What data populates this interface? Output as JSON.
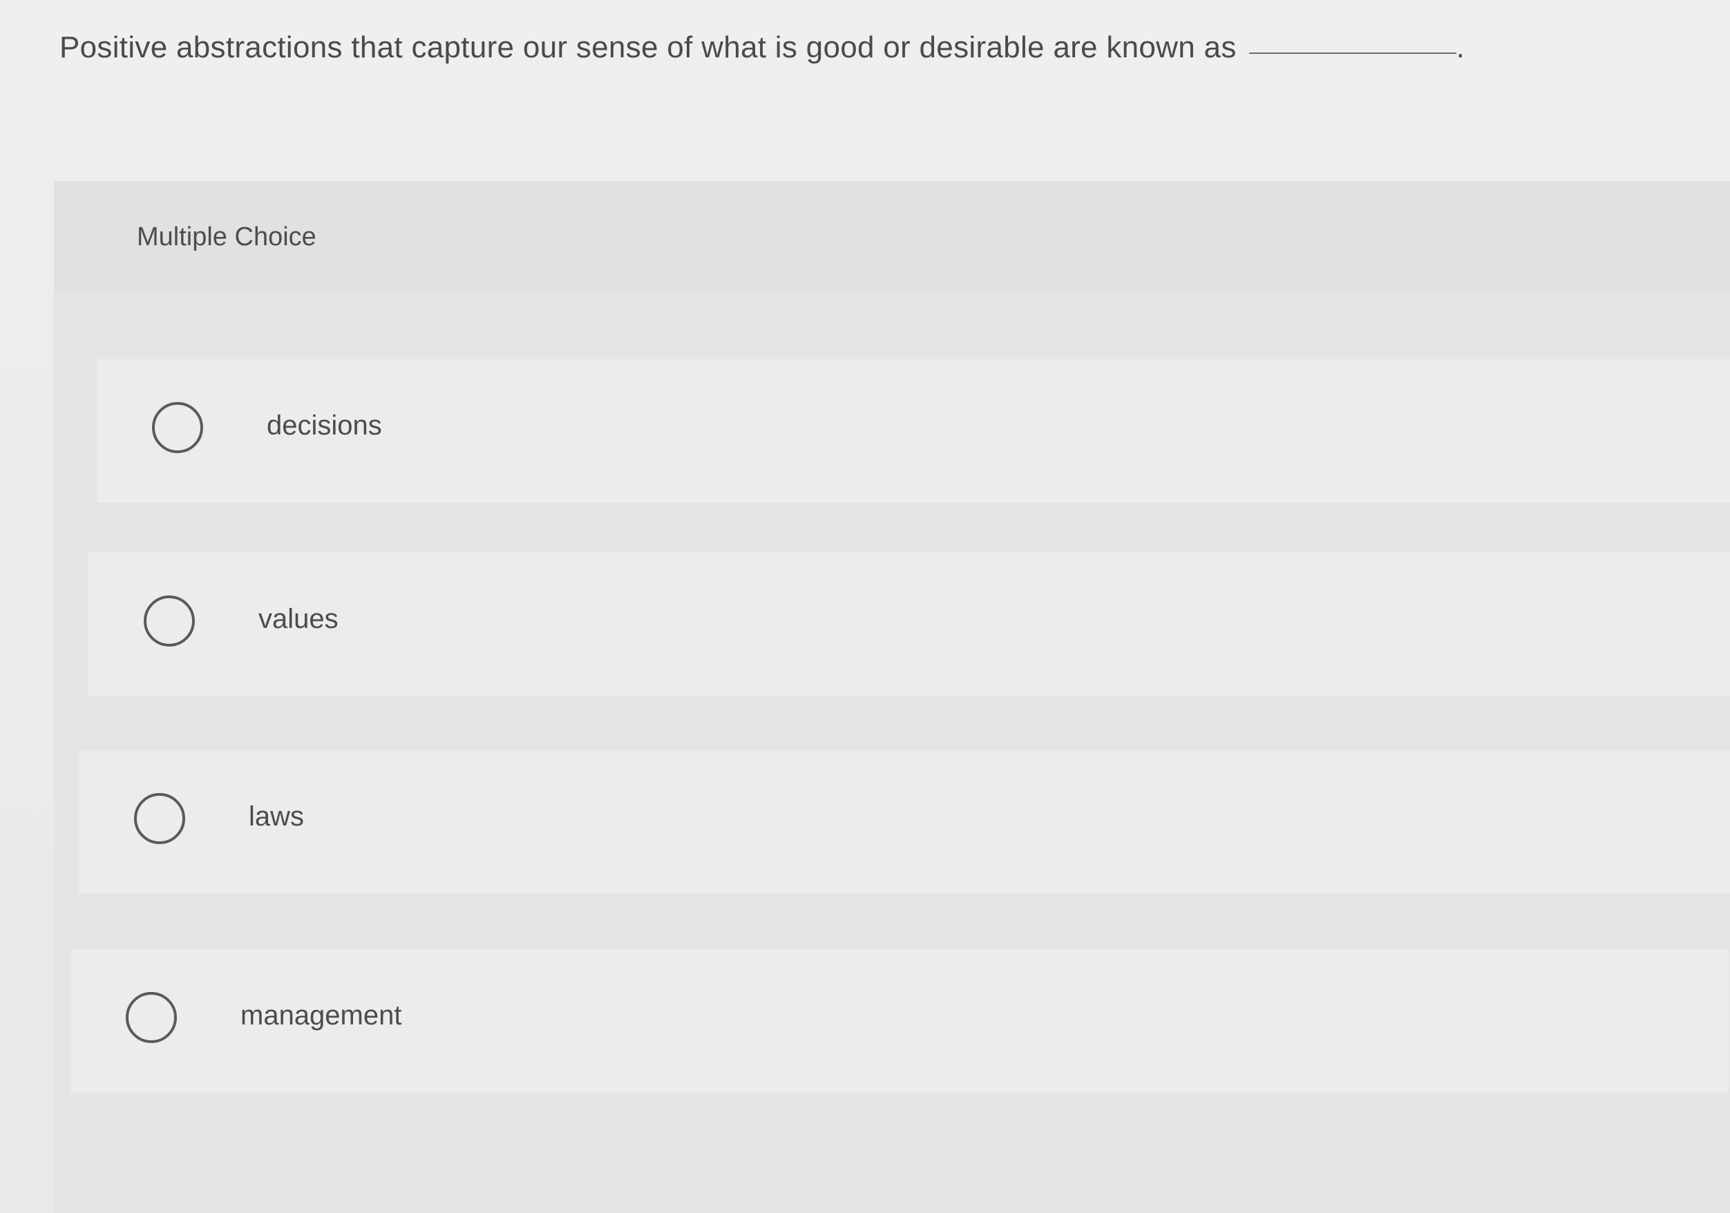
{
  "question": {
    "text": "Positive abstractions that capture our sense of what is good or desirable are known as",
    "trailing_punctuation": "."
  },
  "panel": {
    "type_label": "Multiple Choice"
  },
  "options": [
    {
      "label": "decisions",
      "selected": false
    },
    {
      "label": "values",
      "selected": false
    },
    {
      "label": "laws",
      "selected": false
    },
    {
      "label": "management",
      "selected": false
    }
  ]
}
